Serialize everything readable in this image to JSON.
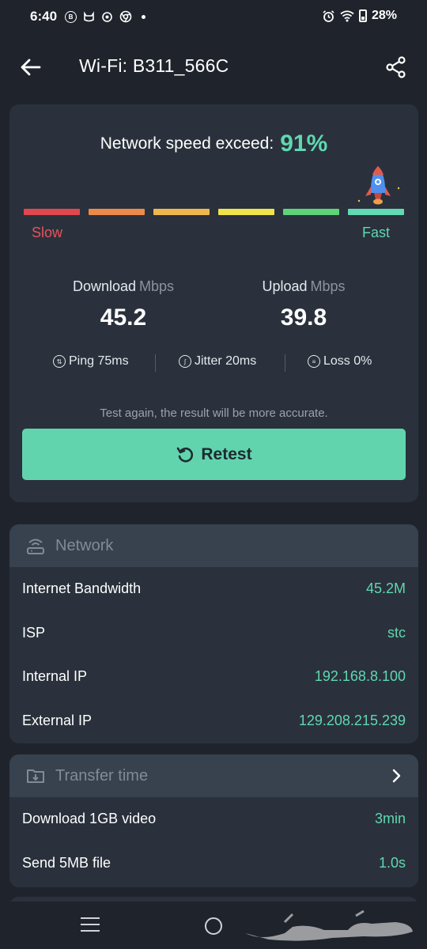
{
  "status_bar": {
    "time": "6:40",
    "left_icons": [
      "notification-b-icon",
      "notification-cat-icon",
      "notification-gear-icon",
      "chrome-icon",
      "more-dot-icon"
    ],
    "right_icons": [
      "alarm-icon",
      "wifi-icon",
      "battery-icon"
    ],
    "battery": "28%"
  },
  "header": {
    "title": "Wi-Fi: B311_566C",
    "back_icon": "arrow-left-icon",
    "share_icon": "share-icon"
  },
  "speed_card": {
    "exceed_label": "Network speed exceed:",
    "exceed_value": "91%",
    "exceed_fraction": 0.91,
    "slow_label": "Slow",
    "fast_label": "Fast",
    "scale_colors": [
      "#e0484f",
      "#ec8a4a",
      "#f0b64e",
      "#efe34c",
      "#5fd378",
      "#61d9b3"
    ],
    "download": {
      "label": "Download",
      "unit": "Mbps",
      "value": "45.2"
    },
    "upload": {
      "label": "Upload",
      "unit": "Mbps",
      "value": "39.8"
    },
    "ping": "Ping 75ms",
    "jitter": "Jitter 20ms",
    "loss": "Loss 0%",
    "hint": "Test again, the result will be more accurate.",
    "retest_label": "Retest"
  },
  "network": {
    "title": "Network",
    "rows": [
      {
        "label": "Internet Bandwidth",
        "value": "45.2M"
      },
      {
        "label": "ISP",
        "value": "stc"
      },
      {
        "label": "Internal IP",
        "value": "192.168.8.100"
      },
      {
        "label": "External IP",
        "value": "129.208.215.239"
      }
    ]
  },
  "transfer": {
    "title": "Transfer time",
    "rows": [
      {
        "label": "Download 1GB video",
        "value": "3min"
      },
      {
        "label": "Send 5MB file",
        "value": "1.0s"
      }
    ]
  },
  "colors": {
    "accent": "#5fd8b0",
    "slow": "#e8535b",
    "background": "#1f242c",
    "card": "#2a313c"
  }
}
